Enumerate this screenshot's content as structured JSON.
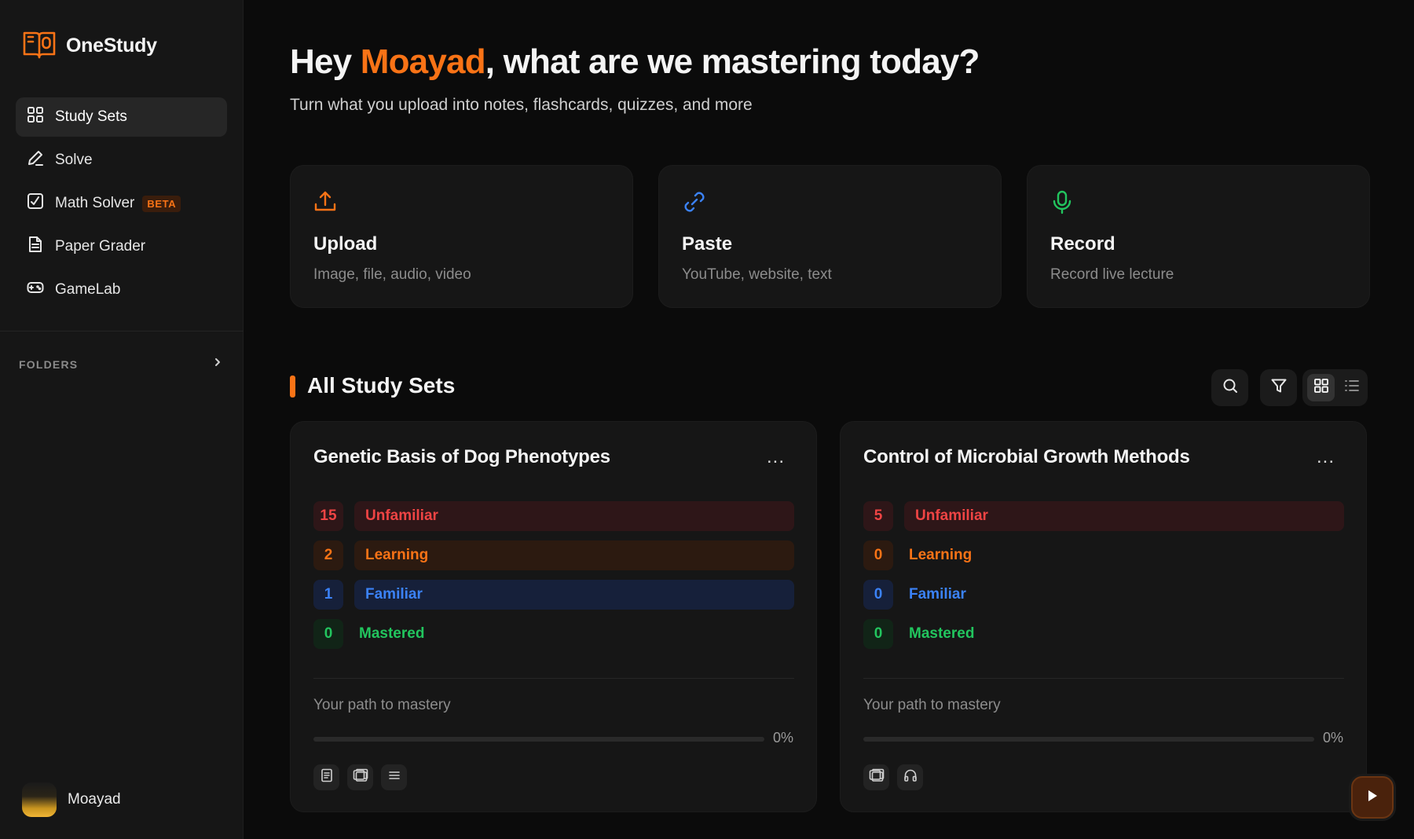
{
  "brand": {
    "name": "OneStudy"
  },
  "sidebar": {
    "items": [
      {
        "label": "Study Sets",
        "icon": "grid-icon",
        "active": true
      },
      {
        "label": "Solve",
        "icon": "pen-icon"
      },
      {
        "label": "Math Solver",
        "icon": "math-icon",
        "badge": "BETA"
      },
      {
        "label": "Paper Grader",
        "icon": "document-icon"
      },
      {
        "label": "GameLab",
        "icon": "gamepad-icon"
      }
    ],
    "folders_label": "FOLDERS",
    "user_name": "Moayad"
  },
  "hero": {
    "greeting_prefix": "Hey ",
    "name": "Moayad",
    "greeting_suffix": ", what are we mastering today?",
    "subtitle": "Turn what you upload into notes, flashcards, quizzes, and more"
  },
  "actions": [
    {
      "title": "Upload",
      "subtitle": "Image, file, audio, video",
      "icon": "upload-icon",
      "color": "#f97316"
    },
    {
      "title": "Paste",
      "subtitle": "YouTube, website, text",
      "icon": "link-icon",
      "color": "#3b82f6"
    },
    {
      "title": "Record",
      "subtitle": "Record live lecture",
      "icon": "microphone-icon",
      "color": "#22c55e"
    }
  ],
  "section": {
    "title": "All Study Sets"
  },
  "colors": {
    "accent": "#f97316",
    "unfamiliar": "#ef4444",
    "learning": "#f97316",
    "familiar": "#3b82f6",
    "mastered": "#22c55e"
  },
  "study_sets": [
    {
      "title": "Genetic Basis of Dog Phenotypes",
      "menu": "...",
      "stats": [
        {
          "count": "15",
          "label": "Unfamiliar"
        },
        {
          "count": "2",
          "label": "Learning"
        },
        {
          "count": "1",
          "label": "Familiar"
        },
        {
          "count": "0",
          "label": "Mastered"
        }
      ],
      "path_label": "Your path to mastery",
      "progress": 0,
      "progress_text": "0%",
      "tools": [
        "notes-icon",
        "flashcards-icon",
        "list-icon"
      ]
    },
    {
      "title": "Control of Microbial Growth Methods",
      "menu": "...",
      "stats": [
        {
          "count": "5",
          "label": "Unfamiliar"
        },
        {
          "count": "0",
          "label": "Learning"
        },
        {
          "count": "0",
          "label": "Familiar"
        },
        {
          "count": "0",
          "label": "Mastered"
        }
      ],
      "path_label": "Your path to mastery",
      "progress": 0,
      "progress_text": "0%",
      "tools": [
        "flashcards-icon",
        "headphones-icon"
      ]
    }
  ]
}
